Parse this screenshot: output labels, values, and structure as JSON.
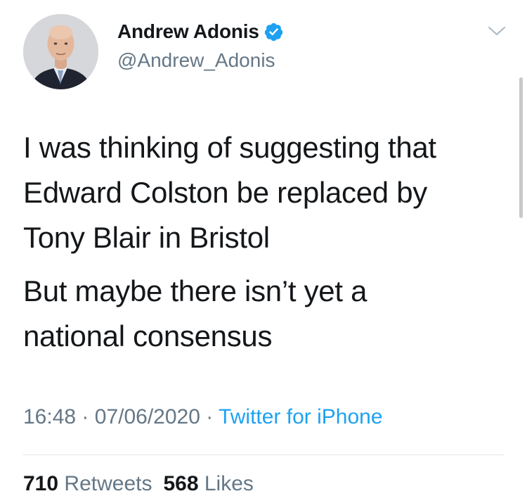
{
  "author": {
    "display_name": "Andrew Adonis",
    "handle": "@Andrew_Adonis",
    "verified_icon": "verified-badge-icon"
  },
  "tweet": {
    "paragraphs": [
      "I was thinking of suggesting that\nEdward Colston be replaced by\nTony Blair in Bristol",
      "But maybe there isn’t yet a\nnational consensus"
    ],
    "time": "16:48",
    "separator": "·",
    "date": "07/06/2020",
    "source": "Twitter for iPhone"
  },
  "stats": {
    "retweets_count": "710",
    "retweets_label": "Retweets",
    "likes_count": "568",
    "likes_label": "Likes"
  },
  "colors": {
    "text": "#14171a",
    "secondary": "#657786",
    "accent": "#1da1f2",
    "divider": "#e1e8ed"
  }
}
